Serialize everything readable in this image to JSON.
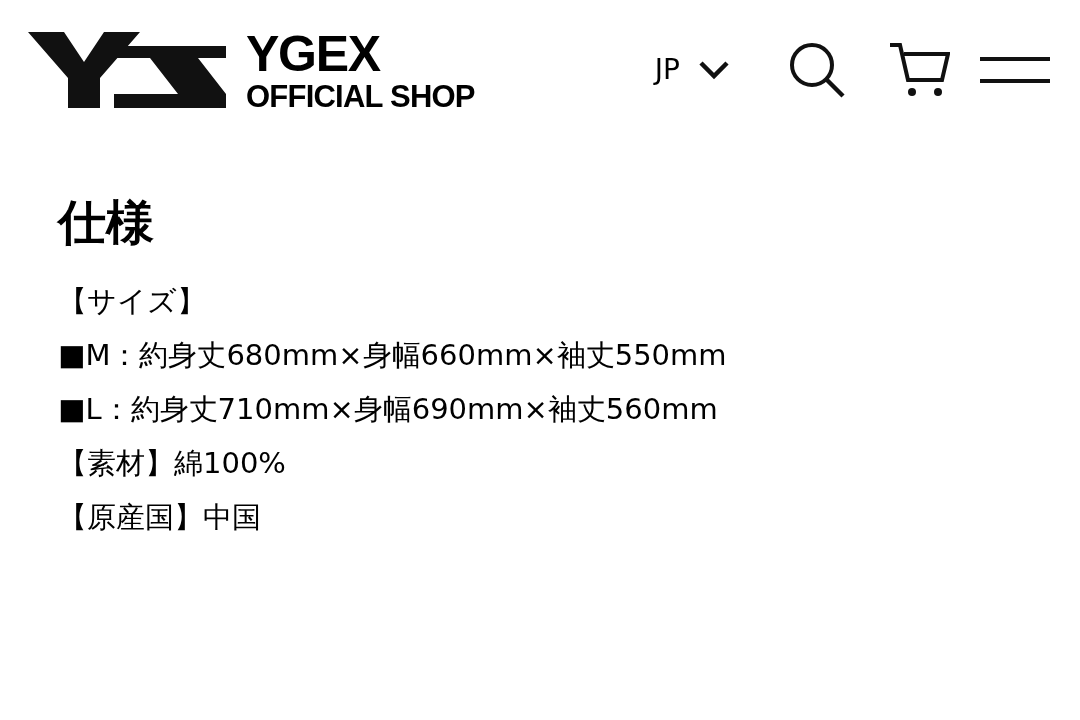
{
  "header": {
    "brand_line1": "YGEX",
    "brand_line2": "OFFICIAL SHOP",
    "language": "JP"
  },
  "section": {
    "title": "仕様",
    "lines": [
      "【サイズ】",
      "■M：約身丈680mm×身幅660mm×袖丈550mm",
      "■L：約身丈710mm×身幅690mm×袖丈560mm",
      "【素材】綿100%",
      "【原産国】中国"
    ]
  }
}
